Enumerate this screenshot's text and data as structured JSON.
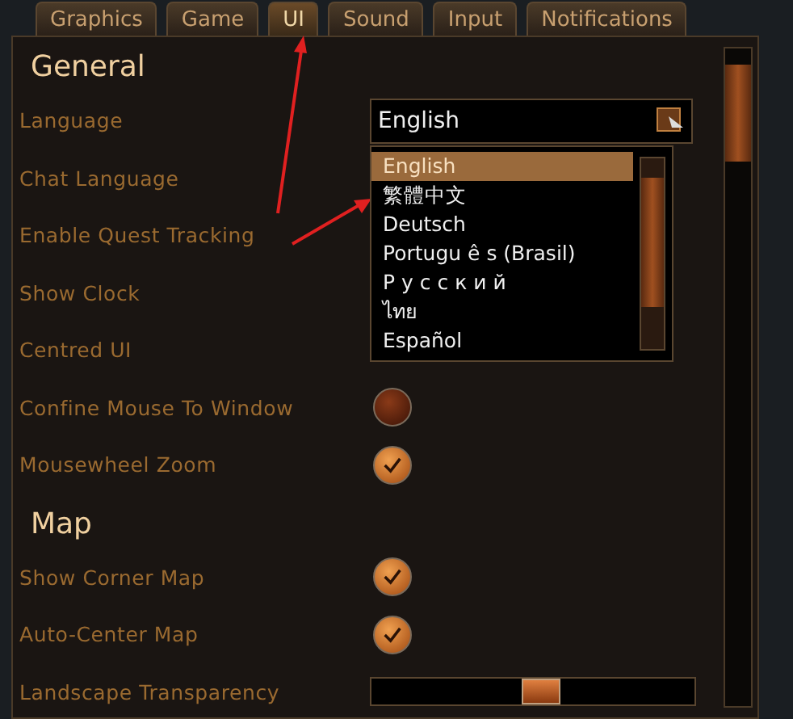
{
  "tabs": [
    {
      "label": "Graphics",
      "selected": false
    },
    {
      "label": "Game",
      "selected": false
    },
    {
      "label": "UI",
      "selected": true
    },
    {
      "label": "Sound",
      "selected": false
    },
    {
      "label": "Input",
      "selected": false
    },
    {
      "label": "Notifications",
      "selected": false
    }
  ],
  "sections": [
    {
      "title": "General",
      "rows": [
        {
          "kind": "select",
          "label": "Language",
          "value": "English",
          "open": true,
          "options": [
            {
              "label": "English",
              "selected": true
            },
            {
              "label": "繁體中文",
              "selected": false
            },
            {
              "label": "Deutsch",
              "selected": false
            },
            {
              "label": "Portugu ê s (Brasil)",
              "selected": false
            },
            {
              "label": "Р у с с к и й",
              "selected": false
            },
            {
              "label": "ไทย",
              "selected": false
            },
            {
              "label": "Español",
              "selected": false
            }
          ]
        },
        {
          "kind": "hidden",
          "label": "Chat Language"
        },
        {
          "kind": "hidden",
          "label": "Enable Quest Tracking"
        },
        {
          "kind": "hidden",
          "label": "Show Clock"
        },
        {
          "kind": "hidden",
          "label": "Centred UI"
        },
        {
          "kind": "checkbox",
          "label": "Confine Mouse To Window",
          "checked": false
        },
        {
          "kind": "checkbox",
          "label": "Mousewheel Zoom",
          "checked": true
        }
      ]
    },
    {
      "title": "Map",
      "rows": [
        {
          "kind": "checkbox",
          "label": "Show Corner Map",
          "checked": true
        },
        {
          "kind": "checkbox",
          "label": "Auto-Center Map",
          "checked": true
        },
        {
          "kind": "slider",
          "label": "Landscape Transparency",
          "level": 0.53
        }
      ]
    }
  ]
}
